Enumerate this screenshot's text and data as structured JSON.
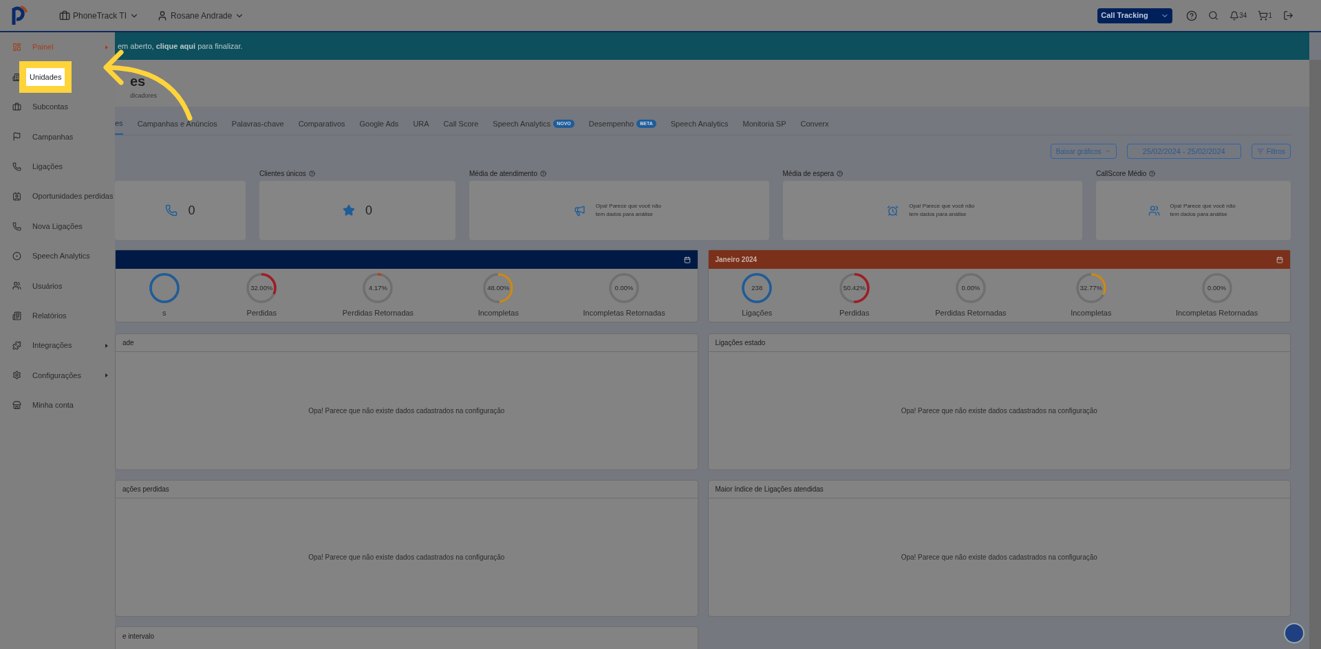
{
  "header": {
    "account": "PhoneTrack TI",
    "user": "Rosane Andrade",
    "product": "Call Tracking",
    "notifications": "34",
    "cart": "1"
  },
  "sidebar": {
    "items": [
      {
        "label": "Painel",
        "selected": true,
        "submenu": true,
        "highlighted": false
      },
      {
        "label": "Unidades",
        "selected": false,
        "submenu": false,
        "highlighted": true
      },
      {
        "label": "Subcontas",
        "selected": false,
        "submenu": false,
        "highlighted": false
      },
      {
        "label": "Campanhas",
        "selected": false,
        "submenu": false,
        "highlighted": false
      },
      {
        "label": "Ligações",
        "selected": false,
        "submenu": false,
        "highlighted": false
      },
      {
        "label": "Oportunidades perdidas",
        "selected": false,
        "submenu": false,
        "highlighted": false
      },
      {
        "label": "Nova Ligações",
        "selected": false,
        "submenu": false,
        "highlighted": false
      },
      {
        "label": "Speech Analytics",
        "selected": false,
        "submenu": false,
        "highlighted": false
      },
      {
        "label": "Usuários",
        "selected": false,
        "submenu": false,
        "highlighted": false
      },
      {
        "label": "Relatórios",
        "selected": false,
        "submenu": false,
        "highlighted": false
      },
      {
        "label": "Integrações",
        "selected": false,
        "submenu": true,
        "highlighted": false
      },
      {
        "label": "Configurações",
        "selected": false,
        "submenu": true,
        "highlighted": false
      },
      {
        "label": "Minha conta",
        "selected": false,
        "submenu": false,
        "highlighted": false
      }
    ]
  },
  "banner": "em aberto, **clique aqui** para finalizar.",
  "page": {
    "title": "es",
    "subtitle": "dicadores"
  },
  "tabs": [
    {
      "label": "es",
      "selected": true
    },
    {
      "label": "Campanhas e Anúncios",
      "selected": false
    },
    {
      "label": "Palavras-chave",
      "selected": false
    },
    {
      "label": "Comparativos",
      "selected": false
    },
    {
      "label": "Google Ads",
      "selected": false
    },
    {
      "label": "URA",
      "selected": false
    },
    {
      "label": "Call Score",
      "selected": false
    },
    {
      "label": "Speech Analytics",
      "selected": false,
      "badge": "NOVO"
    },
    {
      "label": "Desempenho",
      "selected": false,
      "badge": "BETA"
    },
    {
      "label": "Speech Analytics",
      "selected": false
    },
    {
      "label": "Monitoria SP",
      "selected": false
    },
    {
      "label": "Converx",
      "selected": false
    }
  ],
  "toolbar": {
    "download": "Baixar gráficos",
    "date_range": "25/02/2024 - 25/02/2024",
    "filters": "Filtros"
  },
  "stats": [
    {
      "kind": "value",
      "value": "0"
    },
    {
      "kind": "value",
      "title": "Clientes únicos",
      "value": "0"
    },
    {
      "kind": "empty",
      "title": "Média de atendimento",
      "message": "Opa! Parece que você não tem dados para análise"
    },
    {
      "kind": "empty",
      "title": "Média de espera",
      "message": "Opa! Parece que você não tem dados para análise"
    },
    {
      "kind": "empty",
      "title": "CallScore Médio",
      "message": "Opa! Parece que você não tem dados para análise"
    }
  ],
  "periods": [
    {
      "color": "#001a45",
      "donuts": [
        {
          "label": "s",
          "level": 1,
          "color": "#1f5c99"
        },
        {
          "value": "32.00%",
          "label": "Perdidas",
          "level": 0.32,
          "color": "#a01c24"
        },
        {
          "value": "4.17%",
          "label": "Perdidas Retornadas",
          "level": 0.0417,
          "color": "#b0451f"
        },
        {
          "value": "48.00%",
          "label": "Incompletas",
          "level": 0.48,
          "color": "#c88a1e"
        },
        {
          "value": "0.00%",
          "label": "Incompletas Retornadas",
          "level": 0
        }
      ]
    },
    {
      "title": "Janeiro 2024",
      "color": "#7a301a",
      "donuts": [
        {
          "value": "238",
          "label": "Ligações",
          "level": 1,
          "color": "#1f5c99"
        },
        {
          "value": "50.42%",
          "label": "Perdidas",
          "level": 0.5042,
          "color": "#a01c24"
        },
        {
          "value": "0.00%",
          "label": "Perdidas Retornadas",
          "level": 0
        },
        {
          "value": "32.77%",
          "label": "Incompletas",
          "level": 0.3277,
          "color": "#c88a1e"
        },
        {
          "value": "0.00%",
          "label": "Incompletas Retornadas",
          "level": 0
        }
      ]
    }
  ],
  "panels": [
    {
      "title": "ade",
      "message": "Opa! Parece que não existe dados cadastrados na configuração"
    },
    {
      "title": "Ligações estado",
      "message": "Opa! Parece que não existe dados cadastrados na configuração"
    },
    {
      "title": "ações perdidas",
      "message": "Opa! Parece que não existe dados cadastrados na configuração"
    },
    {
      "title": "Maior índice de Ligações atendidas",
      "message": "Opa! Parece que não existe dados cadastrados na configuração"
    }
  ],
  "footer_panel": {
    "title": "e intervalo"
  }
}
